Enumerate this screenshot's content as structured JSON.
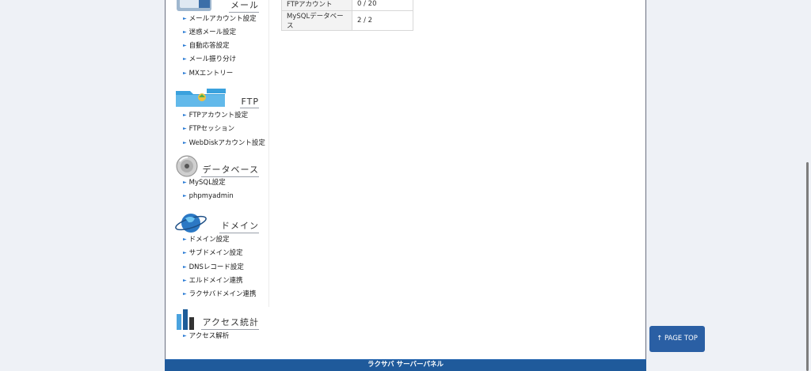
{
  "sidebar": {
    "mail": {
      "title": "メール",
      "items": [
        "メールアカウント設定",
        "迷惑メール設定",
        "自動応答設定",
        "メール振り分け",
        "MXエントリー"
      ]
    },
    "ftp": {
      "title": "FTP",
      "items": [
        "FTPアカウント設定",
        "FTPセッション",
        "WebDiskアカウント設定"
      ]
    },
    "database": {
      "title": "データベース",
      "items": [
        "MySQL設定",
        "phpmyadmin"
      ]
    },
    "domain": {
      "title": "ドメイン",
      "items": [
        "ドメイン設定",
        "サブドメイン設定",
        "DNSレコード設定",
        "エルドメイン連携",
        "ラクサバドメイン連携"
      ]
    },
    "stats": {
      "title": "アクセス統計",
      "items": [
        "アクセス解析"
      ]
    }
  },
  "usage_table": {
    "rows": [
      {
        "label": "FTPアカウント",
        "value": "0 / 20"
      },
      {
        "label": "MySQLデータベース",
        "value": "2 / 2"
      }
    ]
  },
  "footer": {
    "text": "ラクサバ サーバーパネル"
  },
  "page_top_button": {
    "label": "↑ PAGE TOP"
  },
  "colors": {
    "footer_bg": "#1f5a9b",
    "page_top_bg": "#2a5fa4",
    "bullet": "#2a7bd4",
    "page_background": "#eef1f6"
  }
}
